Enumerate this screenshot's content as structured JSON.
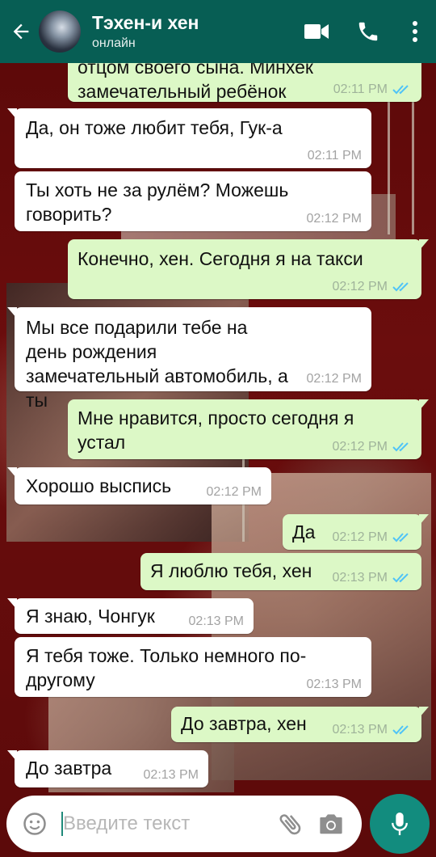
{
  "header": {
    "title": "Тэхен-и хен",
    "status": "онлайн",
    "icons": [
      "back-arrow-icon",
      "video-call-icon",
      "phone-icon",
      "more-vert-icon"
    ]
  },
  "messages": [
    {
      "direction": "out",
      "text": "отцом своего сына. Минхек замечательный ребёнок",
      "time": "02:11 PM",
      "read": true
    },
    {
      "direction": "in",
      "text": "Да, он тоже любит тебя, Гук-а",
      "time": "02:11 PM"
    },
    {
      "direction": "in",
      "text": "Ты хоть не за рулём? Можешь говорить?",
      "time": "02:12 PM"
    },
    {
      "direction": "out",
      "text": "Конечно, хен. Сегодня я на такси",
      "time": "02:12 PM",
      "read": true
    },
    {
      "direction": "in",
      "text": "Мы все подарили тебе на день рождения замечательный автомобиль, а ты",
      "time": "02:12 PM"
    },
    {
      "direction": "out",
      "text": "Мне нравится, просто сегодня я устал",
      "time": "02:12 PM",
      "read": true
    },
    {
      "direction": "in",
      "text": "Хорошо выспись",
      "time": "02:12 PM"
    },
    {
      "direction": "out",
      "text": "Да",
      "time": "02:12 PM",
      "read": true
    },
    {
      "direction": "out",
      "text": "Я люблю тебя, хен",
      "time": "02:13 PM",
      "read": true
    },
    {
      "direction": "in",
      "text": "Я знаю, Чонгук",
      "time": "02:13 PM"
    },
    {
      "direction": "in",
      "text": "Я тебя тоже. Только немного по-другому",
      "time": "02:13 PM"
    },
    {
      "direction": "out",
      "text": "До завтра, хен",
      "time": "02:13 PM",
      "read": true
    },
    {
      "direction": "in",
      "text": "До завтра",
      "time": "02:13 PM"
    }
  ],
  "input": {
    "placeholder": "Введите текст",
    "icons": [
      "emoji-icon",
      "attach-icon",
      "camera-icon",
      "mic-icon"
    ]
  },
  "colors": {
    "header": "#075e54",
    "outgoing_bubble": "#dcf8c6",
    "incoming_bubble": "#ffffff",
    "read_tick": "#4fc3f7",
    "mic_button": "#128c7e"
  }
}
